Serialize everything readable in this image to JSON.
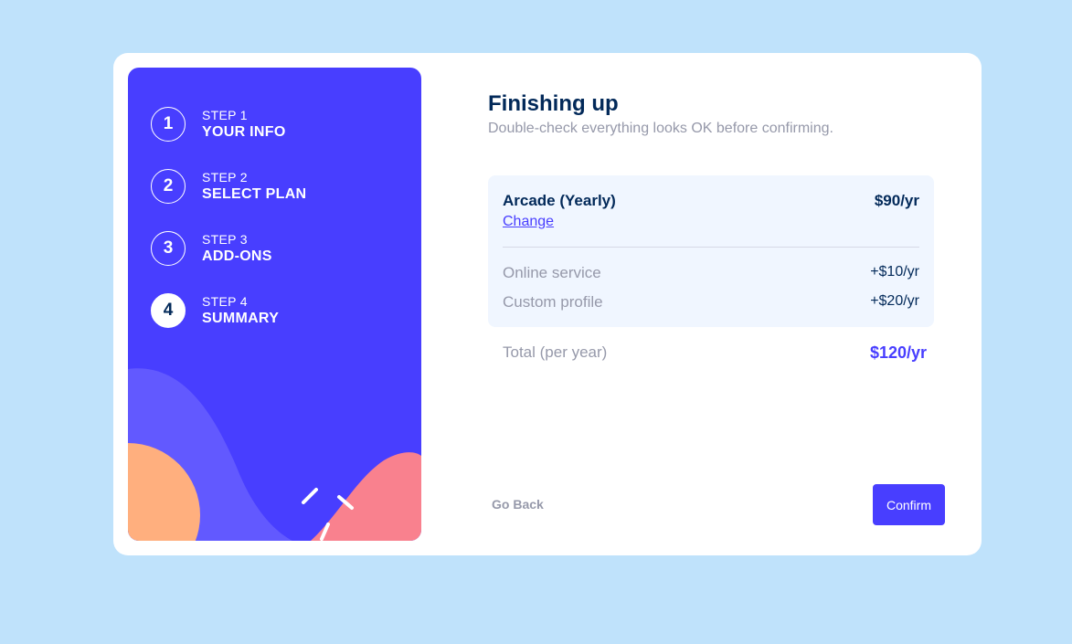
{
  "steps": [
    {
      "number": "1",
      "label": "STEP 1",
      "title": "YOUR INFO",
      "active": false
    },
    {
      "number": "2",
      "label": "STEP 2",
      "title": "SELECT PLAN",
      "active": false
    },
    {
      "number": "3",
      "label": "STEP 3",
      "title": "ADD-ONS",
      "active": false
    },
    {
      "number": "4",
      "label": "STEP 4",
      "title": "SUMMARY",
      "active": true
    }
  ],
  "header": {
    "title": "Finishing up",
    "subtitle": "Double-check everything looks OK before confirming."
  },
  "summary": {
    "plan_name": "Arcade (Yearly)",
    "plan_price": "$90/yr",
    "change_label": "Change",
    "addons": [
      {
        "name": "Online service",
        "price": "+$10/yr"
      },
      {
        "name": "Custom profile",
        "price": "+$20/yr"
      }
    ],
    "total_label": "Total (per year)",
    "total_price": "$120/yr"
  },
  "footer": {
    "back_label": "Go Back",
    "confirm_label": "Confirm"
  },
  "colors": {
    "page_bg": "#bfe2fb",
    "sidebar_bg": "#483eff",
    "primary": "#483eff",
    "denim": "#022959",
    "grey": "#9699aa",
    "summary_bg": "#f0f6ff",
    "shape_orange": "#ffaf7e",
    "shape_pink": "#f9818e",
    "shape_purple": "#6259ff"
  }
}
